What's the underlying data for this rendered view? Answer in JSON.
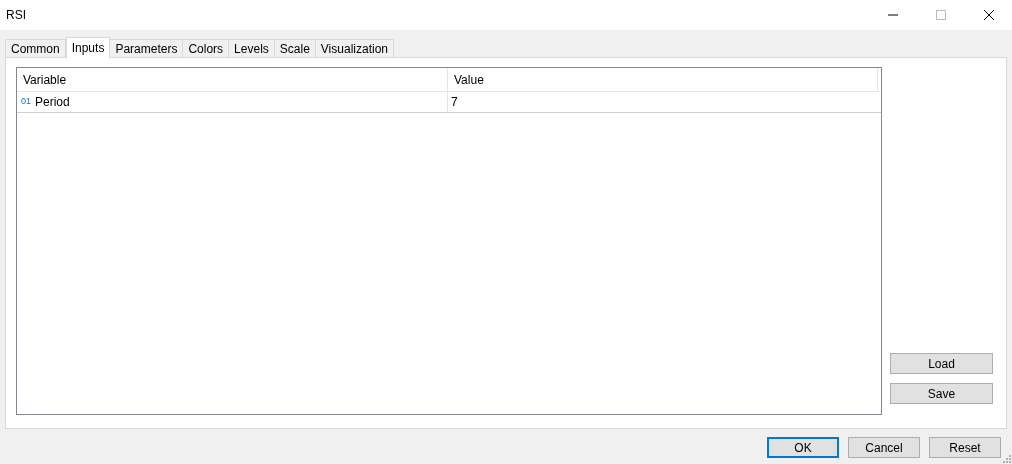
{
  "window": {
    "title": "RSI"
  },
  "tabs": [
    {
      "label": "Common",
      "selected": false
    },
    {
      "label": "Inputs",
      "selected": true
    },
    {
      "label": "Parameters",
      "selected": false
    },
    {
      "label": "Colors",
      "selected": false
    },
    {
      "label": "Levels",
      "selected": false
    },
    {
      "label": "Scale",
      "selected": false
    },
    {
      "label": "Visualization",
      "selected": false
    }
  ],
  "table": {
    "columns": [
      "Variable",
      "Value"
    ],
    "rows": [
      {
        "type_badge": "01",
        "variable": "Period",
        "value": "7"
      }
    ]
  },
  "side_buttons": [
    "Load",
    "Save"
  ],
  "buttons": [
    {
      "label": "OK",
      "default": true
    },
    {
      "label": "Cancel",
      "default": false
    },
    {
      "label": "Reset",
      "default": false
    }
  ]
}
